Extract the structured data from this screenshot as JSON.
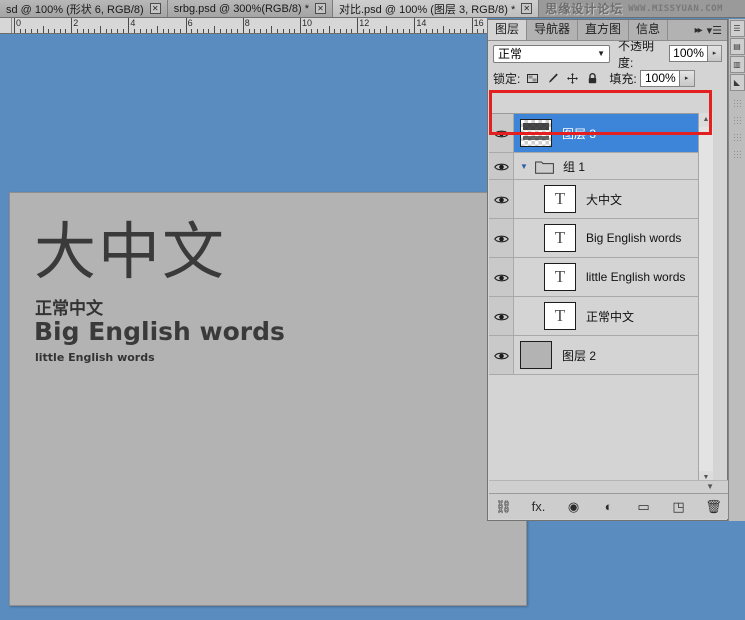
{
  "document_tabs": [
    {
      "label": "sd @ 100% (形状 6, RGB/8)",
      "close": "✕",
      "active": false
    },
    {
      "label": "srbg.psd @ 300%(RGB/8) *",
      "close": "✕",
      "active": false
    },
    {
      "label": "对比.psd @ 100% (图层 3, RGB/8) *",
      "close": "✕",
      "active": true
    }
  ],
  "watermark": {
    "cn": "思缘设计论坛",
    "en": "WWW.MISSYUAN.COM"
  },
  "ruler": {
    "labels": [
      "0",
      "2",
      "4",
      "6",
      "8",
      "10",
      "12",
      "14",
      "16"
    ]
  },
  "canvas": {
    "big_chinese": "大中文",
    "normal_chinese": "正常中文",
    "big_english": "Big English words",
    "little_english": "little English words",
    "background_color": "#b3b3b3"
  },
  "panel": {
    "tabs": [
      {
        "label": "图层",
        "active": true
      },
      {
        "label": "导航器",
        "active": false
      },
      {
        "label": "直方图",
        "active": false
      },
      {
        "label": "信息",
        "active": false
      }
    ],
    "collapse_icon": "▸▸",
    "menu_icon": "▾☰",
    "blend_mode": {
      "value": "正常",
      "caret": "▼"
    },
    "opacity": {
      "label": "不透明度:",
      "value": "100%",
      "spinner": "▸"
    },
    "lock": {
      "label": "锁定:",
      "icons": [
        "transparency-lock-icon",
        "brush-lock-icon",
        "move-lock-icon",
        "all-lock-icon"
      ]
    },
    "fill": {
      "label": "填充:",
      "value": "100%",
      "spinner": "▸"
    },
    "layers": [
      {
        "name": "图层 3",
        "thumb": "checker",
        "selected": true,
        "indent": false,
        "type": "pixel"
      },
      {
        "name": "组 1",
        "thumb": "folder",
        "selected": false,
        "indent": false,
        "type": "group",
        "arrow": "▼"
      },
      {
        "name": "大中文",
        "thumb": "text",
        "thumb_glyph": "T",
        "selected": false,
        "indent": true,
        "type": "text"
      },
      {
        "name": "Big English words",
        "thumb": "text",
        "thumb_glyph": "T",
        "selected": false,
        "indent": true,
        "type": "text"
      },
      {
        "name": "little English words",
        "thumb": "text",
        "thumb_glyph": "T",
        "selected": false,
        "indent": true,
        "type": "text"
      },
      {
        "name": "正常中文",
        "thumb": "text",
        "thumb_glyph": "T",
        "selected": false,
        "indent": true,
        "type": "text"
      },
      {
        "name": "图层 2",
        "thumb": "solid",
        "selected": false,
        "indent": false,
        "type": "pixel"
      }
    ],
    "footer_buttons": [
      {
        "name": "link-layers-button",
        "glyph": "⛓"
      },
      {
        "name": "layer-style-fx-button",
        "glyph": "fx."
      },
      {
        "name": "add-layer-mask-button",
        "glyph": "◉"
      },
      {
        "name": "adjustment-layer-button",
        "glyph": "◐"
      },
      {
        "name": "new-group-button",
        "glyph": "▭"
      },
      {
        "name": "new-layer-button",
        "glyph": "◳"
      },
      {
        "name": "delete-layer-button",
        "glyph": "🗑"
      }
    ],
    "scroll": {
      "up": "▲",
      "down": "▼"
    }
  },
  "annotation": {
    "color": "#e41f1f",
    "target": "图层 3"
  },
  "background_color": "#5b8cc0"
}
